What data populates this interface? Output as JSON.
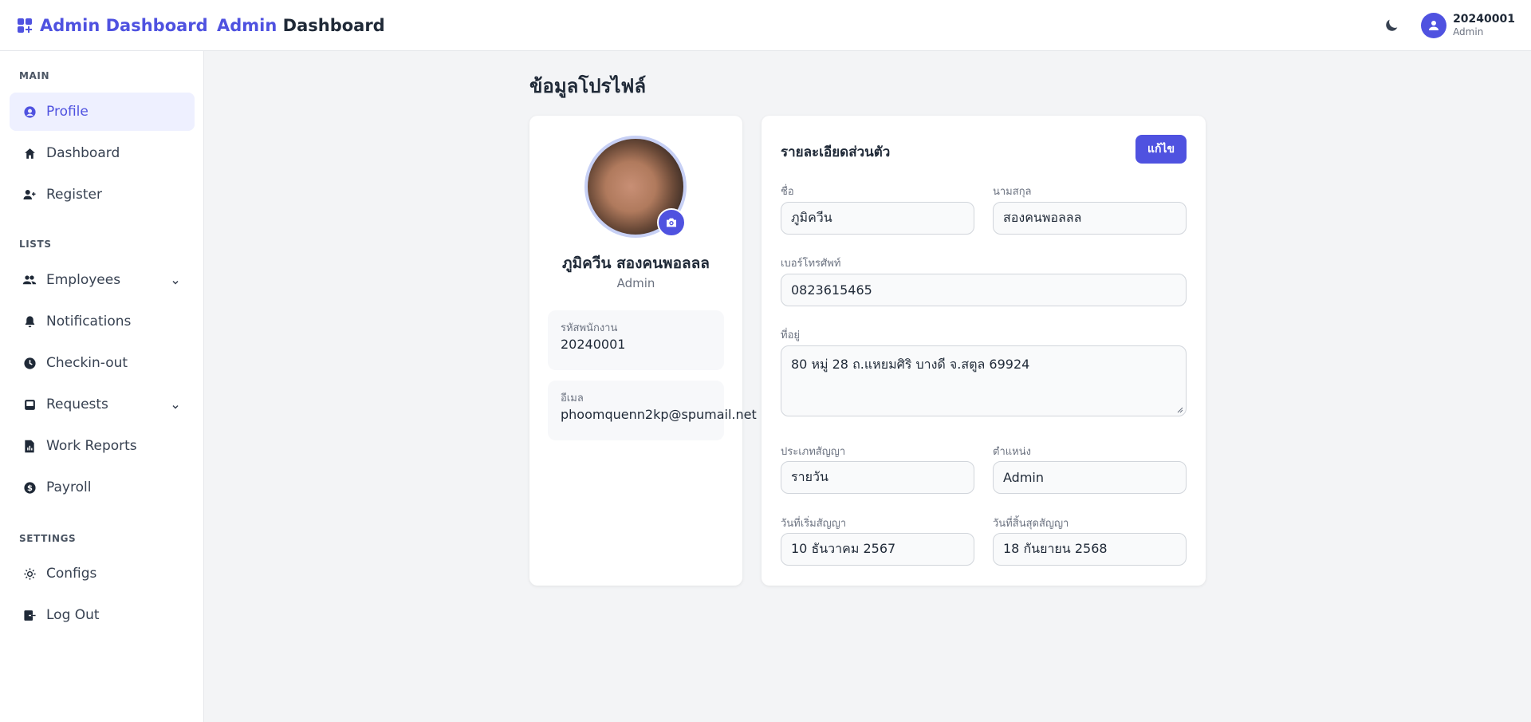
{
  "header": {
    "brand": "Admin Dashboard",
    "title_accent": "Admin",
    "title_rest": "Dashboard",
    "user_id": "20240001",
    "user_role": "Admin"
  },
  "sidebar": {
    "sections": {
      "main": "MAIN",
      "lists": "LISTS",
      "settings": "SETTINGS"
    },
    "items": [
      {
        "label": "Profile",
        "icon": "user-circle-icon",
        "active": true
      },
      {
        "label": "Dashboard",
        "icon": "home-icon"
      },
      {
        "label": "Register",
        "icon": "user-plus-icon"
      },
      {
        "label": "Employees",
        "icon": "users-icon",
        "expandable": true
      },
      {
        "label": "Notifications",
        "icon": "bell-icon"
      },
      {
        "label": "Checkin-out",
        "icon": "clock-icon"
      },
      {
        "label": "Requests",
        "icon": "inbox-icon",
        "expandable": true
      },
      {
        "label": "Work Reports",
        "icon": "report-icon"
      },
      {
        "label": "Payroll",
        "icon": "dollar-icon"
      },
      {
        "label": "Configs",
        "icon": "gear-icon"
      },
      {
        "label": "Log Out",
        "icon": "logout-icon"
      }
    ]
  },
  "main": {
    "page_title": "ข้อมูลโปรไฟล์",
    "profile": {
      "name": "ภูมิควีน สองคนพอลลล",
      "role": "Admin",
      "employee_id_label": "รหัสพนักงาน",
      "employee_id": "20240001",
      "email_label": "อีเมล",
      "email": "phoomquenn2kp@spumail.net"
    },
    "details": {
      "title": "รายละเอียดส่วนตัว",
      "edit_label": "แก้ไข",
      "first_name_label": "ชื่อ",
      "first_name": "ภูมิควีน",
      "last_name_label": "นามสกุล",
      "last_name": "สองคนพอลลล",
      "phone_label": "เบอร์โทรศัพท์",
      "phone": "0823615465",
      "address_label": "ที่อยู่",
      "address": "80 หมู่ 28 ถ.แหยมศิริ บางดี จ.สตูล 69924",
      "contract_type_label": "ประเภทสัญญา",
      "contract_type": "รายวัน",
      "position_label": "ตำแหน่ง",
      "position": "Admin",
      "start_date_label": "วันที่เริ่มสัญญา",
      "start_date": "10 ธันวาคม 2567",
      "end_date_label": "วันที่สิ้นสุดสัญญา",
      "end_date": "18 กันยายน 2568"
    }
  },
  "colors": {
    "accent": "#4f52e0",
    "active_bg": "#eef0ff"
  }
}
